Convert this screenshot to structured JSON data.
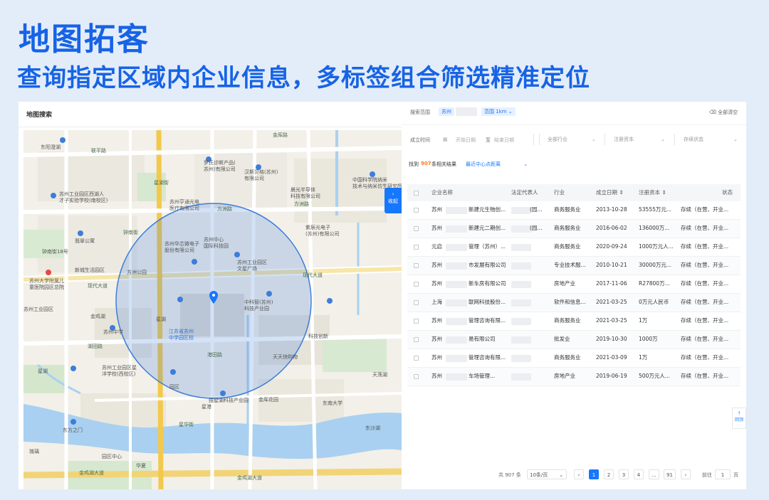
{
  "hero": {
    "title": "地图拓客",
    "subtitle": "查询指定区域内企业信息，多标签组合筛选精准定位"
  },
  "colors": {
    "accent": "#1763e6",
    "primary": "#1677ff",
    "map_circle": "#2f6fd4"
  },
  "map_panel": {
    "title": "地图搜索",
    "collapse_icon": "chevron-right-icon",
    "collapse_label": "收起",
    "labels": [
      "东阳澄湖",
      "联平路",
      "金厍路",
      "苏州工业园区西湖人",
      "才子实验学校(南校区)",
      "罗氏诊断产品(",
      "苏州)有限公司",
      "汉斯贝格(苏州)",
      "有限公司",
      "中国科学院纳米",
      "技术与纳米仿生研究所",
      "苏州亨通光电",
      "医疗有限公司",
      "晨光半导体",
      "科技有限公司",
      "方洲路",
      "方洲路",
      "钟南街18号",
      "翡翠公寓",
      "苏州华芯微电子",
      "股份有限公司",
      "紫辰光电子",
      "(苏州)有限公司",
      "新城生活园区",
      "苏州中心",
      "国际科技园",
      "苏州工业园区",
      "文星广场",
      "中科智(苏州)",
      "科技产业园",
      "苏州大学附属儿",
      "童医院园区总院",
      "现代大道",
      "现代大道",
      "星湖街",
      "钟南街",
      "方洲公园",
      "苏州工业园区",
      "金鸡湖",
      "星湖",
      "江苏省苏州",
      "中学园区校",
      "湖田路",
      "苏州中学",
      "园区",
      "港田路",
      "天天快购物",
      "科技创新",
      "苏州工业园区星",
      "洋学校(西校区)",
      "星湖",
      "星港",
      "星华街",
      "独墅湖科技产业园",
      "东方之门",
      "金厍花园",
      "琉璃",
      "园区中心",
      "华夏",
      "东南大学",
      "金鸡湖大道",
      "金鸡湖大道",
      "东沙湖",
      "天荡湖"
    ]
  },
  "search": {
    "range_label": "搜索范围",
    "city_value": "苏州",
    "radius_label": "范围",
    "radius_value": "1km",
    "clear_icon": "trash-icon",
    "clear_label": "全部清空"
  },
  "filters": {
    "founded_label": "成立时间",
    "calendar_icon": "calendar-icon",
    "start_placeholder": "开始日期",
    "to_label": "至",
    "end_placeholder": "结束日期",
    "industry_placeholder": "全部行业",
    "capital_placeholder": "注册资本",
    "status_placeholder": "存续状态"
  },
  "result": {
    "prefix": "找到",
    "count": "907",
    "suffix": "条相关结果",
    "sort_label": "最近中心点距离",
    "sort_icon": "chevron-down-icon"
  },
  "table": {
    "headers": [
      "企业名称",
      "法定代表人",
      "行业",
      "成立日期",
      "注册资本",
      "状态"
    ],
    "rows": [
      {
        "name_pre": "苏州",
        "name_post": "新建元生物创...",
        "rep": "(园...",
        "industry": "商务服务业",
        "date": "2013-10-28",
        "capital": "53555万元...",
        "status": "存续（在营、开业..."
      },
      {
        "name_pre": "苏州",
        "name_post": "新建元二期创...",
        "rep": "(园...",
        "industry": "商务服务业",
        "date": "2016-06-02",
        "capital": "136000万...",
        "status": "存续（在营、开业..."
      },
      {
        "name_pre": "元启",
        "name_post": "管理（苏州）...",
        "rep": "",
        "industry": "商务服务业",
        "date": "2020-09-24",
        "capital": "1000万元人...",
        "status": "存续（在营、开业..."
      },
      {
        "name_pre": "苏州",
        "name_post": "市发展有限公司",
        "rep": "",
        "industry": "专业技术服...",
        "date": "2010-10-21",
        "capital": "30000万元...",
        "status": "存续（在营、开业..."
      },
      {
        "name_pre": "苏州",
        "name_post": "新车房有限公司",
        "rep": "",
        "industry": "房地产业",
        "date": "2017-11-06",
        "capital": "R27800万...",
        "status": "存续（在营、开业..."
      },
      {
        "name_pre": "上海",
        "name_post": "联网科技股份...",
        "rep": "",
        "industry": "软件和信息...",
        "date": "2021-03-25",
        "capital": "0万元人民币",
        "status": "存续（在营、开业..."
      },
      {
        "name_pre": "苏州",
        "name_post": "管理咨询有限...",
        "rep": "",
        "industry": "商务服务业",
        "date": "2021-03-25",
        "capital": "1万",
        "status": "存续（在营、开业..."
      },
      {
        "name_pre": "苏州",
        "name_post": "易有限公司",
        "rep": "",
        "industry": "批发业",
        "date": "2019-10-30",
        "capital": "1000万",
        "status": "存续（在营、开业..."
      },
      {
        "name_pre": "苏州",
        "name_post": "管理咨询有限...",
        "rep": "",
        "industry": "商务服务业",
        "date": "2021-03-09",
        "capital": "1万",
        "status": "存续（在营、开业..."
      },
      {
        "name_pre": "苏州",
        "name_post": "车场管理...",
        "rep": "",
        "industry": "房地产业",
        "date": "2019-06-19",
        "capital": "500万元人...",
        "status": "存续（在营、开业..."
      }
    ]
  },
  "pagination": {
    "total": "共 907 条",
    "page_size": "10条/页",
    "pages": [
      "1",
      "2",
      "3",
      "4",
      "...",
      "91"
    ],
    "goto_label": "前往",
    "goto_value": "1",
    "page_unit": "页",
    "prev_icon": "chevron-left-icon",
    "next_icon": "chevron-right-icon"
  },
  "back_top": {
    "icon": "arrow-up-icon",
    "label": "回顶"
  }
}
